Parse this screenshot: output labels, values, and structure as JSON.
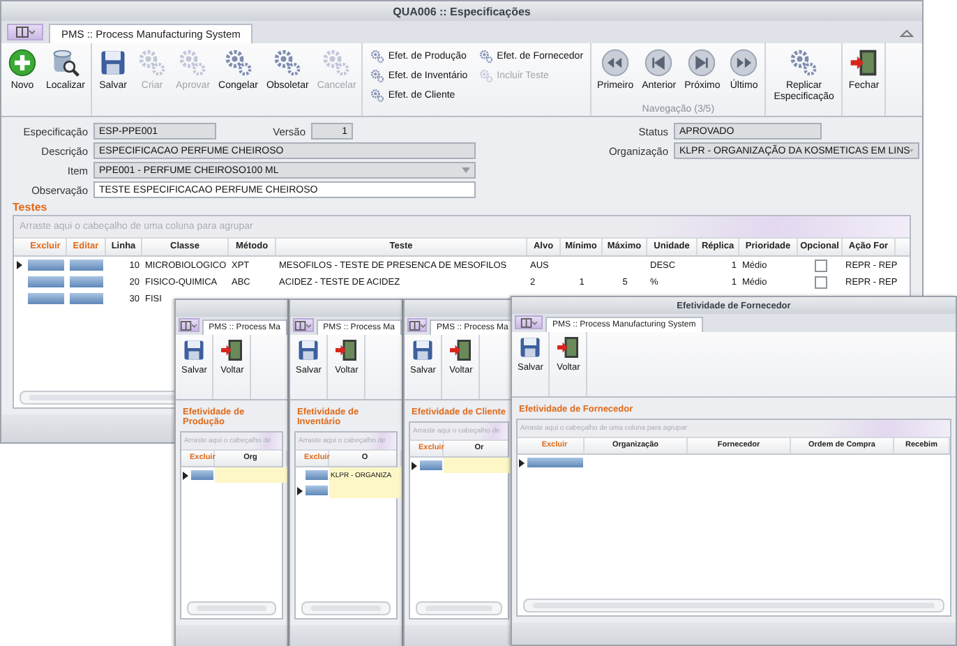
{
  "window": {
    "title": "QUA006 :: Especificações"
  },
  "tab": {
    "label": "PMS :: Process Manufacturing System",
    "selected": true
  },
  "ribbon": [
    {
      "kind": "large",
      "buttons": [
        {
          "label": "Novo",
          "kind": "add",
          "disabled": false
        },
        {
          "label": "Localizar",
          "kind": "find",
          "disabled": false
        }
      ]
    },
    {
      "kind": "large",
      "buttons": [
        {
          "label": "Salvar",
          "kind": "save",
          "disabled": false
        },
        {
          "label": "Criar",
          "kind": "gear",
          "disabled": true
        },
        {
          "label": "Aprovar",
          "kind": "gear",
          "disabled": true
        },
        {
          "label": "Congelar",
          "kind": "gear",
          "disabled": false
        },
        {
          "label": "Obsoletar",
          "kind": "gear",
          "disabled": false
        },
        {
          "label": "Cancelar",
          "kind": "gear",
          "disabled": true
        }
      ]
    },
    {
      "kind": "small",
      "columns": [
        [
          {
            "label": "Efet. de Produção",
            "disabled": false
          },
          {
            "label": "Efet. de Inventário",
            "disabled": false
          },
          {
            "label": "Efet. de Cliente",
            "disabled": false
          }
        ],
        [
          {
            "label": "Efet. de Fornecedor",
            "disabled": false
          },
          {
            "label": "Incluir Teste",
            "disabled": true
          }
        ]
      ]
    },
    {
      "kind": "large",
      "label": "Navegação (3/5)",
      "buttons": [
        {
          "label": "Primeiro",
          "kind": "first",
          "disabled": false
        },
        {
          "label": "Anterior",
          "kind": "prev",
          "disabled": false
        },
        {
          "label": "Próximo",
          "kind": "next",
          "disabled": false
        },
        {
          "label": "Último",
          "kind": "last",
          "disabled": false
        }
      ]
    },
    {
      "kind": "large",
      "buttons": [
        {
          "label": "Replicar Especificação",
          "kind": "gear",
          "disabled": false
        }
      ]
    },
    {
      "kind": "large",
      "buttons": [
        {
          "label": "Fechar",
          "kind": "exit",
          "disabled": false
        }
      ]
    }
  ],
  "form": {
    "left": [
      [
        {
          "label": "Especificação",
          "value": "ESP-PPE001",
          "kind": "text",
          "readonly": true
        },
        {
          "label": "Versão",
          "value": "1",
          "kind": "number",
          "readonly": true
        }
      ],
      [
        {
          "label": "Descrição",
          "value": "ESPECIFICACAO PERFUME CHEIROSO",
          "kind": "text",
          "readonly": true
        }
      ],
      [
        {
          "label": "Item",
          "value": "PPE001 - PERFUME CHEIROSO100 ML",
          "kind": "combo",
          "readonly": true
        }
      ],
      [
        {
          "label": "Observação",
          "value": "TESTE ESPECIFICACAO PERFUME CHEIROSO",
          "kind": "text",
          "readonly": false
        }
      ]
    ],
    "right": [
      [
        {
          "label": "Status",
          "value": "APROVADO",
          "kind": "text",
          "readonly": true
        }
      ],
      [
        {
          "label": "Organização",
          "value": "KLPR - ORGANIZAÇÃO DA KOSMETICAS EM LINS",
          "kind": "combo",
          "readonly": true
        }
      ]
    ]
  },
  "tests": {
    "title": "Testes",
    "group_hint": "Arraste aqui o cabeçalho de uma coluna para agrupar",
    "columns": [
      {
        "label": "Excluir",
        "kind": "action"
      },
      {
        "label": "Editar",
        "kind": "action"
      },
      {
        "label": "Linha",
        "kind": "number"
      },
      {
        "label": "Classe",
        "kind": "text"
      },
      {
        "label": "Método",
        "kind": "text"
      },
      {
        "label": "Teste",
        "kind": "text"
      },
      {
        "label": "Alvo",
        "kind": "text"
      },
      {
        "label": "Mínimo",
        "kind": "center"
      },
      {
        "label": "Máximo",
        "kind": "center"
      },
      {
        "label": "Unidade",
        "kind": "text"
      },
      {
        "label": "Réplica",
        "kind": "number"
      },
      {
        "label": "Prioridade",
        "kind": "text"
      },
      {
        "label": "Opcional",
        "kind": "check"
      },
      {
        "label": "Ação For",
        "kind": "text"
      }
    ],
    "rows": [
      {
        "current": true,
        "opcional": false,
        "cells": [
          "",
          "",
          "10",
          "MICROBIOLOGICO",
          "XPT",
          "MESOFILOS - TESTE DE PRESENCA DE MESOFILOS",
          "AUS",
          "",
          "",
          "DESC",
          "1",
          "Médio",
          "",
          "REPR - REP"
        ]
      },
      {
        "current": false,
        "opcional": false,
        "cells": [
          "",
          "",
          "20",
          "FISICO-QUIMICA",
          "ABC",
          "ACIDEZ - TESTE DE ACIDEZ",
          "2",
          "1",
          "5",
          "%",
          "1",
          "Médio",
          "",
          "REPR - REP"
        ]
      },
      {
        "current": false,
        "cells": [
          "",
          "",
          "30",
          "FISI"
        ]
      }
    ]
  },
  "dialogs": [
    {
      "tab_label": "PMS :: Process Ma",
      "buttons": [
        {
          "label": "Salvar",
          "kind": "save"
        },
        {
          "label": "Voltar",
          "kind": "exit"
        }
      ],
      "section": "Efetividade de Produção",
      "group_hint": "Arraste aqui o cabeçalho de",
      "columns": [
        {
          "label": "Excluir",
          "kind": "action"
        },
        {
          "label": "Org",
          "kind": "text",
          "focused": true
        }
      ],
      "rows": [
        {
          "current": true,
          "cells": []
        }
      ]
    },
    {
      "tab_label": "PMS :: Process Ma",
      "buttons": [
        {
          "label": "Salvar",
          "kind": "save"
        },
        {
          "label": "Voltar",
          "kind": "exit"
        }
      ],
      "section": "Efetividade de Inventário",
      "group_hint": "Arraste aqui o cabeçalho de",
      "columns": [
        {
          "label": "Excluir",
          "kind": "action"
        },
        {
          "label": "O",
          "kind": "text",
          "focused": true
        }
      ],
      "rows": [
        {
          "current": false,
          "cells": [
            "",
            "KLPR - ORGANIZA"
          ]
        },
        {
          "current": true,
          "cells": []
        }
      ]
    },
    {
      "tab_label": "PMS :: Process Ma",
      "buttons": [
        {
          "label": "Salvar",
          "kind": "save"
        },
        {
          "label": "Voltar",
          "kind": "exit"
        }
      ],
      "section": "Efetividade de Cliente",
      "group_hint": "Arraste aqui o cabeçalho de",
      "columns": [
        {
          "label": "Excluir",
          "kind": "action"
        },
        {
          "label": "Or",
          "kind": "text",
          "focused": true
        }
      ],
      "rows": [
        {
          "current": true,
          "cells": []
        }
      ]
    },
    {
      "title": "Efetividade de Fornecedor",
      "tab_label": "PMS :: Process Manufacturing System",
      "buttons": [
        {
          "label": "Salvar",
          "kind": "save"
        },
        {
          "label": "Voltar",
          "kind": "exit"
        }
      ],
      "section": "Efetividade de Fornecedor",
      "group_hint": "Arraste aqui o cabeçalho de uma coluna para agrupar",
      "columns": [
        {
          "label": "Excluir",
          "kind": "action"
        },
        {
          "label": "Organização",
          "kind": "text",
          "focused": false
        },
        {
          "label": "Fornecedor",
          "kind": "text",
          "focused": false
        },
        {
          "label": "Ordem de Compra",
          "kind": "text",
          "focused": false
        },
        {
          "label": "Recebim",
          "kind": "text",
          "focused": false
        }
      ],
      "rows": [
        {
          "current": true,
          "cells": []
        }
      ]
    }
  ]
}
